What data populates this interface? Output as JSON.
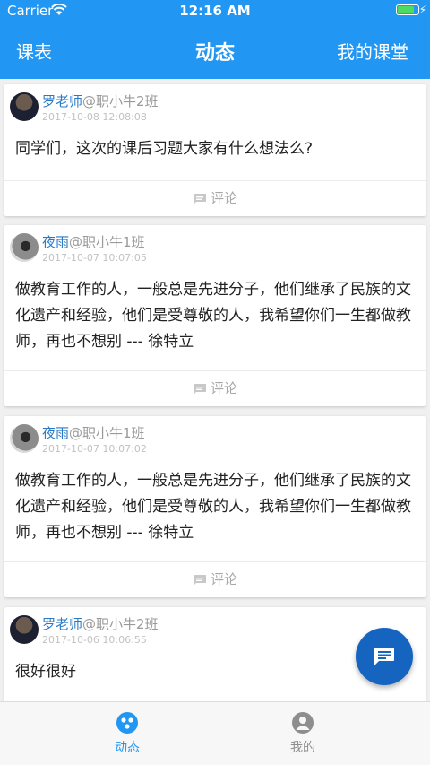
{
  "status_bar": {
    "carrier": "Carrier",
    "time": "12:16 AM"
  },
  "nav": {
    "left_label": "课表",
    "title": "动态",
    "right_label": "我的课堂"
  },
  "posts": [
    {
      "author": "罗老师",
      "class_tag": "@职小牛2班",
      "timestamp": "2017-10-08 12:08:08",
      "content": "同学们，这次的课后习题大家有什么想法么?",
      "comment_label": "评论",
      "avatar_style": "dark"
    },
    {
      "author": "夜雨",
      "class_tag": "@职小牛1班",
      "timestamp": "2017-10-07 10:07:05",
      "content": "做教育工作的人，一般总是先进分子，他们继承了民族的文化遗产和经验，他们是受尊敬的人，我希望你们一生都做教师，再也不想别 --- 徐特立",
      "comment_label": "评论",
      "avatar_style": "gray"
    },
    {
      "author": "夜雨",
      "class_tag": "@职小牛1班",
      "timestamp": "2017-10-07 10:07:02",
      "content": "做教育工作的人，一般总是先进分子，他们继承了民族的文化遗产和经验，他们是受尊敬的人，我希望你们一生都做教师，再也不想别 --- 徐特立",
      "comment_label": "评论",
      "avatar_style": "gray"
    },
    {
      "author": "罗老师",
      "class_tag": "@职小牛2班",
      "timestamp": "2017-10-06 10:06:55",
      "content": "很好很好",
      "comment_label": "评论",
      "avatar_style": "dark"
    }
  ],
  "tab_bar": {
    "tabs": [
      {
        "label": "动态",
        "active": true,
        "icon": "feed-icon"
      },
      {
        "label": "我的",
        "active": false,
        "icon": "profile-icon"
      }
    ]
  },
  "colors": {
    "primary": "#2196F3",
    "fab": "#1565C0",
    "tab_active": "#2196F3",
    "tab_inactive": "#8e8e8e",
    "author_name": "#2979c5"
  }
}
